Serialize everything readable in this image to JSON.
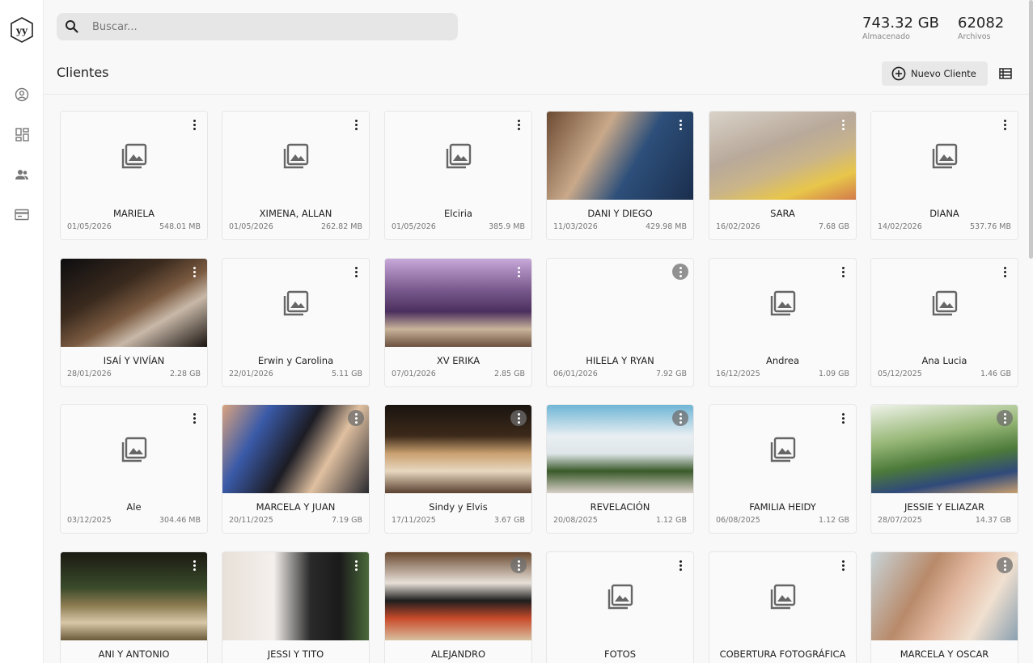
{
  "header": {
    "search_placeholder": "Buscar...",
    "storage_value": "743.32 GB",
    "storage_label": "Almacenado",
    "files_value": "62082",
    "files_label": "Archivos"
  },
  "page": {
    "title": "Clientes",
    "new_client_label": "Nuevo Cliente"
  },
  "clients": [
    {
      "name": "MARIELA",
      "date": "01/05/2026",
      "size": "548.01 MB",
      "thumb": "placeholder"
    },
    {
      "name": "XIMENA, ALLAN",
      "date": "01/05/2026",
      "size": "262.82 MB",
      "thumb": "placeholder"
    },
    {
      "name": "Elciria",
      "date": "01/05/2026",
      "size": "385.9 MB",
      "thumb": "placeholder"
    },
    {
      "name": "DANI Y DIEGO",
      "date": "11/03/2026",
      "size": "429.98 MB",
      "thumb": "photo"
    },
    {
      "name": "SARA",
      "date": "16/02/2026",
      "size": "7.68 GB",
      "thumb": "photo"
    },
    {
      "name": "DIANA",
      "date": "14/02/2026",
      "size": "537.76 MB",
      "thumb": "placeholder"
    },
    {
      "name": "ISAÍ Y VIVÍAN",
      "date": "28/01/2026",
      "size": "2.28 GB",
      "thumb": "photo"
    },
    {
      "name": "Erwin y Carolina",
      "date": "22/01/2026",
      "size": "5.11 GB",
      "thumb": "placeholder"
    },
    {
      "name": "XV ERIKA",
      "date": "07/01/2026",
      "size": "2.85 GB",
      "thumb": "photo"
    },
    {
      "name": "HILELA Y RYAN",
      "date": "06/01/2026",
      "size": "7.92 GB",
      "thumb": "blank"
    },
    {
      "name": "Andrea",
      "date": "16/12/2025",
      "size": "1.09 GB",
      "thumb": "placeholder"
    },
    {
      "name": "Ana Lucia",
      "date": "05/12/2025",
      "size": "1.46 GB",
      "thumb": "placeholder"
    },
    {
      "name": "Ale",
      "date": "03/12/2025",
      "size": "304.46 MB",
      "thumb": "placeholder"
    },
    {
      "name": "MARCELA Y JUAN",
      "date": "20/11/2025",
      "size": "7.19 GB",
      "thumb": "photo"
    },
    {
      "name": "Sindy y Elvis",
      "date": "17/11/2025",
      "size": "3.67 GB",
      "thumb": "photo"
    },
    {
      "name": "REVELACIÓN",
      "date": "20/08/2025",
      "size": "1.12 GB",
      "thumb": "photo"
    },
    {
      "name": "FAMILIA HEIDY",
      "date": "06/08/2025",
      "size": "1.12 GB",
      "thumb": "placeholder"
    },
    {
      "name": "JESSIE Y ELIAZAR",
      "date": "28/07/2025",
      "size": "14.37 GB",
      "thumb": "photo"
    },
    {
      "name": "ANI Y ANTONIO",
      "date": "",
      "size": "",
      "thumb": "photo"
    },
    {
      "name": "JESSI Y TITO",
      "date": "",
      "size": "",
      "thumb": "photo"
    },
    {
      "name": "ALEJANDRO",
      "date": "",
      "size": "",
      "thumb": "photo"
    },
    {
      "name": "FOTOS",
      "date": "",
      "size": "",
      "thumb": "placeholder"
    },
    {
      "name": "COBERTURA FOTOGRÁFICA",
      "date": "",
      "size": "",
      "thumb": "placeholder"
    },
    {
      "name": "MARCELA Y OSCAR",
      "date": "",
      "size": "",
      "thumb": "photo"
    }
  ]
}
